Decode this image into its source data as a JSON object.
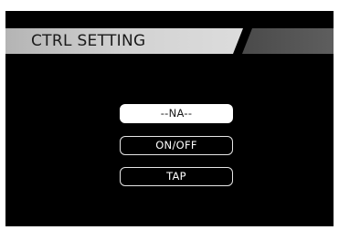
{
  "header": {
    "title": "CTRL SETTING"
  },
  "options": [
    {
      "label": "--NA--",
      "selected": true
    },
    {
      "label": "ON/OFF",
      "selected": false
    },
    {
      "label": "TAP",
      "selected": false
    }
  ],
  "colors": {
    "background": "#000000",
    "header_light": "#c8c8c8",
    "header_dark": "#505050",
    "selected_bg": "#ffffff",
    "button_border": "#e6e6e6"
  }
}
